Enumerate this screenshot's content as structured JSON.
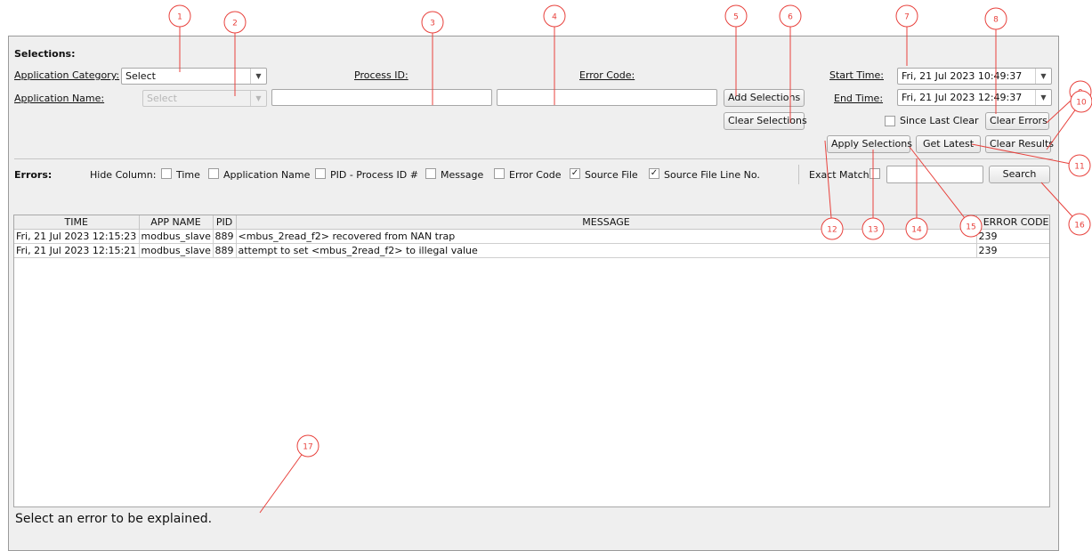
{
  "selections": {
    "header": "Selections:",
    "app_category_label": "Application Category:",
    "app_category_value": "Select",
    "app_name_label": "Application Name:",
    "app_name_value": "Select",
    "process_id_label": "Process ID:",
    "error_code_label": "Error Code:",
    "start_time_label": "Start Time:",
    "start_time_value": "Fri, 21 Jul 2023 10:49:37",
    "end_time_label": "End Time:",
    "end_time_value": "Fri, 21 Jul 2023 12:49:37",
    "add_button": "Add Selections",
    "clear_button": "Clear Selections",
    "since_last_clear_label": "Since Last Clear",
    "clear_errors_button": "Clear Errors",
    "apply_button": "Apply Selections",
    "get_latest_button": "Get Latest",
    "clear_results_button": "Clear Results"
  },
  "errors": {
    "header": "Errors:",
    "hide_column_label": "Hide Column:",
    "hide_columns": [
      {
        "label": "Time",
        "checked": false
      },
      {
        "label": "Application Name",
        "checked": false
      },
      {
        "label": "PID - Process ID #",
        "checked": false
      },
      {
        "label": "Message",
        "checked": false
      },
      {
        "label": "Error Code",
        "checked": false
      },
      {
        "label": "Source File",
        "checked": true
      },
      {
        "label": "Source File Line No.",
        "checked": true
      }
    ],
    "exact_match_label": "Exact Match",
    "search_button": "Search"
  },
  "table": {
    "columns": [
      "TIME",
      "APP NAME",
      "PID",
      "MESSAGE",
      "ERROR CODE"
    ],
    "rows": [
      [
        "Fri, 21 Jul 2023 12:15:23",
        "modbus_slave",
        "889",
        "<mbus_2read_f2> recovered from NAN trap",
        "239"
      ],
      [
        "Fri, 21 Jul 2023 12:15:21",
        "modbus_slave",
        "889",
        "attempt to set <mbus_2read_f2> to illegal value",
        "239"
      ]
    ]
  },
  "explain_text": "Select an error to be explained.",
  "callouts": [
    "1",
    "2",
    "3",
    "4",
    "5",
    "6",
    "7",
    "8",
    "9",
    "10",
    "11",
    "12",
    "13",
    "14",
    "15",
    "16",
    "17"
  ],
  "colors": {
    "callout": "#e8413c",
    "panel": "#efefef"
  }
}
